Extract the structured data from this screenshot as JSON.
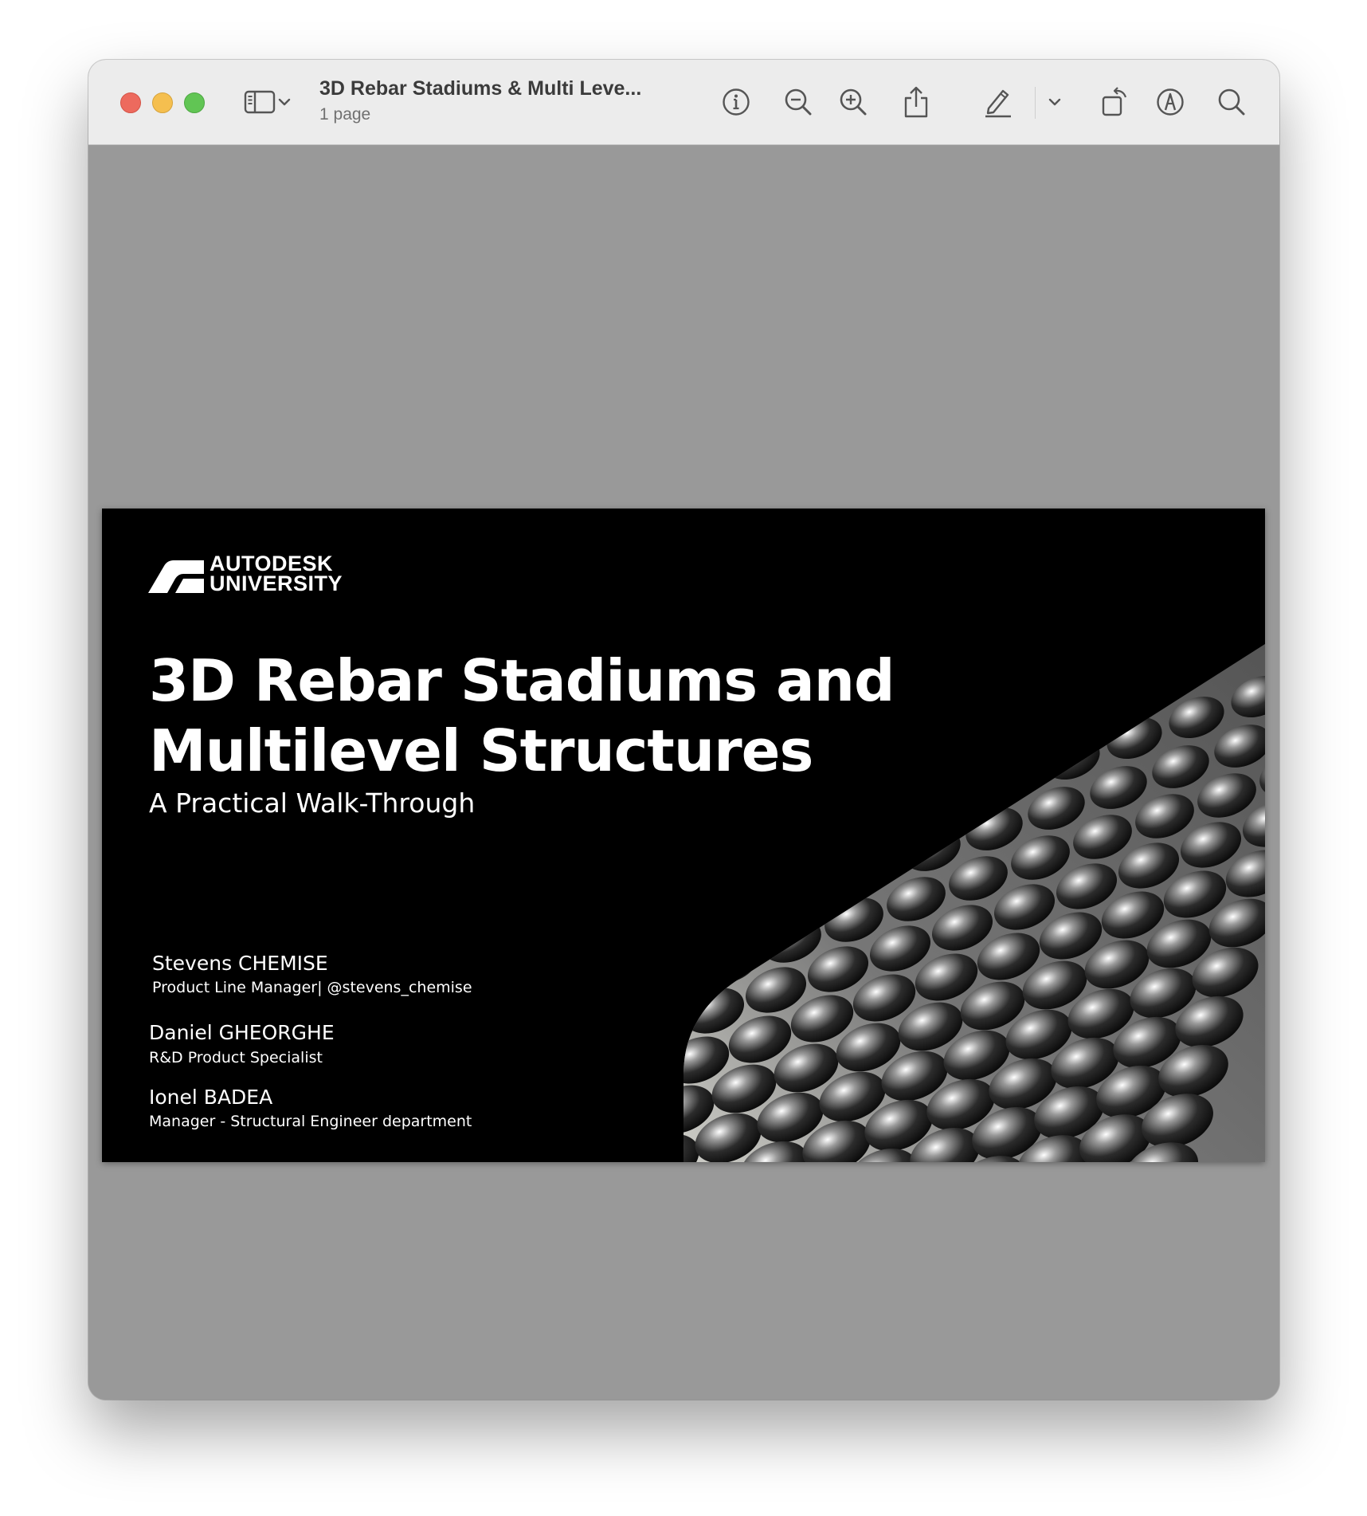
{
  "window": {
    "title": "3D Rebar Stadiums & Multi Leve...",
    "subtitle": "1 page"
  },
  "toolbar": {
    "icons": [
      "sidebar-icon",
      "chevron-down-icon",
      "info-icon",
      "zoom-out-icon",
      "zoom-in-icon",
      "share-icon",
      "pencil-icon",
      "chevron-down-icon",
      "rotate-icon",
      "markup-icon",
      "search-icon"
    ]
  },
  "slide": {
    "logo_line1": "AUTODESK",
    "logo_line2": "UNIVERSITY",
    "title_line1": "3D Rebar Stadiums and",
    "title_line2": "Multilevel Structures",
    "subtitle": "A Practical Walk-Through",
    "presenters": [
      {
        "name": "Stevens CHEMISE",
        "role": "Product Line Manager| @stevens_chemise"
      },
      {
        "name": "Daniel GHEORGHE",
        "role": "R&D Product Specialist"
      },
      {
        "name": "Ionel BADEA",
        "role": "Manager - Structural Engineer department"
      }
    ]
  }
}
